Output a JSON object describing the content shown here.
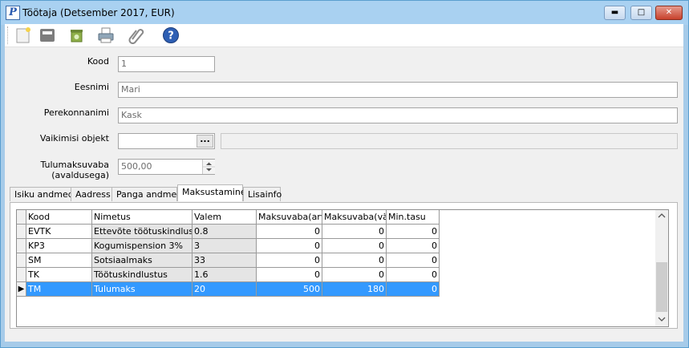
{
  "window": {
    "title": "Töötaja (Detsember 2017, EUR)",
    "app_icon_letter": "P",
    "controls": {
      "minimize": "▬",
      "maximize": "□",
      "close": "✕"
    }
  },
  "toolbar": {
    "items": [
      {
        "name": "new-icon"
      },
      {
        "name": "save-icon"
      },
      {
        "name": "delete-icon"
      },
      {
        "name": "print-icon"
      },
      {
        "name": "attachment-icon"
      },
      {
        "name": "help-icon"
      }
    ]
  },
  "form": {
    "kood": {
      "label": "Kood",
      "value": "1"
    },
    "eesnimi": {
      "label": "Eesnimi",
      "value": "Mari"
    },
    "perekonnanimi": {
      "label": "Perekonnanimi",
      "value": "Kask"
    },
    "vaikimisi_objekt": {
      "label": "Vaikimisi objekt",
      "value": "",
      "button": "..."
    },
    "tulumaksuvaba": {
      "label_line1": "Tulumaksuvaba",
      "label_line2": "(avaldusega)",
      "value": "500,00"
    }
  },
  "tabs": [
    {
      "label": "Isiku andmed"
    },
    {
      "label": "Aadress"
    },
    {
      "label": "Panga andmed"
    },
    {
      "label": "Maksustamine",
      "active": true
    },
    {
      "label": "Lisainfo"
    }
  ],
  "grid": {
    "columns": [
      "Kood",
      "Nimetus",
      "Valem",
      "Maksuvaba(arve",
      "Maksuvaba(välj",
      "Min.tasu"
    ],
    "rows": [
      {
        "kood": "EVTK",
        "nimetus": "Ettevõte töötuskindlustus",
        "valem": "0.8",
        "m1": "0",
        "m2": "0",
        "min": "0"
      },
      {
        "kood": "KP3",
        "nimetus": "Kogumispension 3%",
        "valem": "3",
        "m1": "0",
        "m2": "0",
        "min": "0"
      },
      {
        "kood": "SM",
        "nimetus": "Sotsiaalmaks",
        "valem": "33",
        "m1": "0",
        "m2": "0",
        "min": "0"
      },
      {
        "kood": "TK",
        "nimetus": "Töötuskindlustus",
        "valem": "1.6",
        "m1": "0",
        "m2": "0",
        "min": "0"
      },
      {
        "kood": "TM",
        "nimetus": "Tulumaks",
        "valem": "20",
        "m1": "500",
        "m2": "180",
        "min": "0",
        "selected": true
      }
    ],
    "current_row_marker": "▶"
  },
  "colors": {
    "selection": "#3399ff",
    "titlebar": "#a9d1f1",
    "readonly_cell": "#e5e5e5"
  }
}
